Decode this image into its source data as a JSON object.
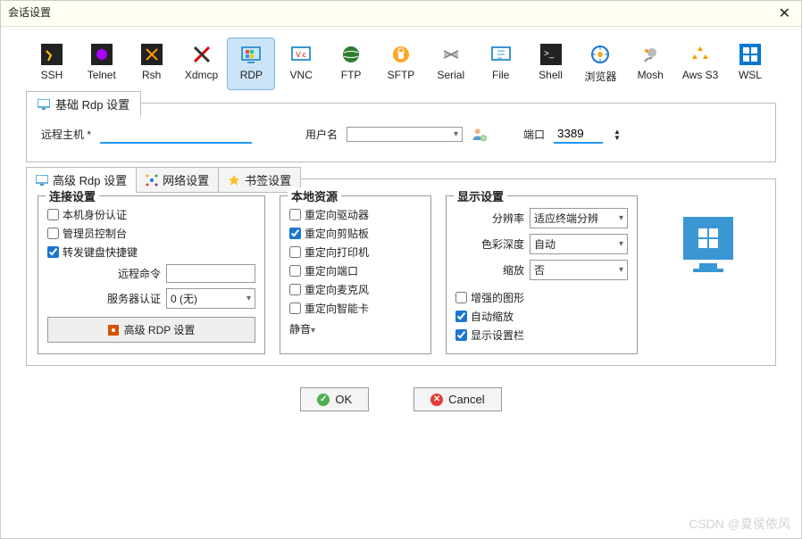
{
  "title": "会话设置",
  "protocols": [
    "SSH",
    "Telnet",
    "Rsh",
    "Xdmcp",
    "RDP",
    "VNC",
    "FTP",
    "SFTP",
    "Serial",
    "File",
    "Shell",
    "浏览器",
    "Mosh",
    "Aws S3",
    "WSL"
  ],
  "protocol_selected_index": 4,
  "basic_tab": {
    "label": "基础 Rdp 设置"
  },
  "basic": {
    "remote_host_label": "远程主机 *",
    "host_value": "",
    "username_label": "用户名",
    "username_value": "",
    "port_label": "端口",
    "port_value": "3389"
  },
  "adv_tabs": {
    "rdp": "高级 Rdp 设置",
    "network": "网络设置",
    "bookmark": "书签设置"
  },
  "conn": {
    "legend": "连接设置",
    "nla": {
      "label": "本机身份认证",
      "checked": false
    },
    "admin": {
      "label": "管理员控制台",
      "checked": false
    },
    "fwd_keys": {
      "label": "转发键盘快捷键",
      "checked": true
    },
    "remote_cmd_label": "远程命令",
    "remote_cmd_value": "",
    "server_auth_label": "服务器认证",
    "server_auth_value": "0 (无)",
    "adv_btn": "高级 RDP 设置"
  },
  "local": {
    "legend": "本地资源",
    "drives": {
      "label": "重定向驱动器",
      "checked": false
    },
    "clipboard": {
      "label": "重定向剪贴板",
      "checked": true
    },
    "printers": {
      "label": "重定向打印机",
      "checked": false
    },
    "ports": {
      "label": "重定向端口",
      "checked": false
    },
    "mic": {
      "label": "重定向麦克风",
      "checked": false
    },
    "smartcard": {
      "label": "重定向智能卡",
      "checked": false
    },
    "audio_value": "静音"
  },
  "display": {
    "legend": "显示设置",
    "resolution_label": "分辨率",
    "resolution_value": "适应终端分辨",
    "color_label": "色彩深度",
    "color_value": "自动",
    "zoom_label": "缩放",
    "zoom_value": "否",
    "enhanced": {
      "label": "增强的图形",
      "checked": false
    },
    "autozoom": {
      "label": "自动缩放",
      "checked": true
    },
    "showbar": {
      "label": "显示设置栏",
      "checked": true
    }
  },
  "buttons": {
    "ok": "OK",
    "cancel": "Cancel"
  },
  "watermark": "CSDN @夏侯依风"
}
